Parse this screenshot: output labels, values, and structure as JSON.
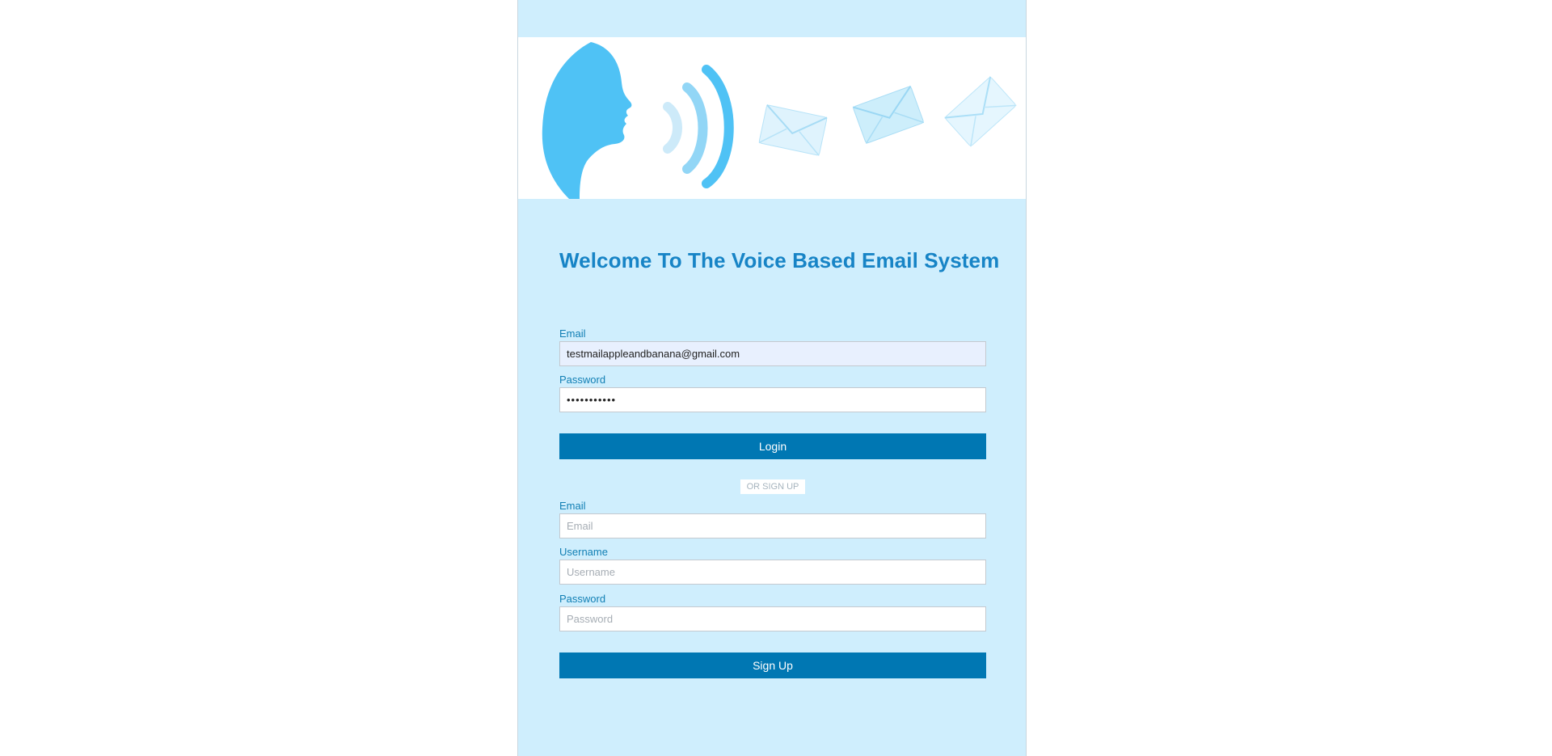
{
  "page": {
    "title": "Welcome To The Voice Based Email System"
  },
  "colors": {
    "panel_background": "#cfeefd",
    "accent": "#0077b3",
    "heading": "#1784c6",
    "label": "#117fb4"
  },
  "banner": {
    "icons": [
      "speaking-head-icon",
      "sound-wave-icon",
      "envelope-icon",
      "envelope-icon",
      "envelope-icon"
    ]
  },
  "login": {
    "email_label": "Email",
    "email_value": "testmailappleandbanana@gmail.com",
    "password_label": "Password",
    "password_value": "•••••••••••",
    "button_label": "Login"
  },
  "divider": {
    "label": "OR SIGN UP"
  },
  "signup": {
    "email_label": "Email",
    "email_placeholder": "Email",
    "username_label": "Username",
    "username_placeholder": "Username",
    "password_label": "Password",
    "password_placeholder": "Password",
    "button_label": "Sign Up"
  }
}
